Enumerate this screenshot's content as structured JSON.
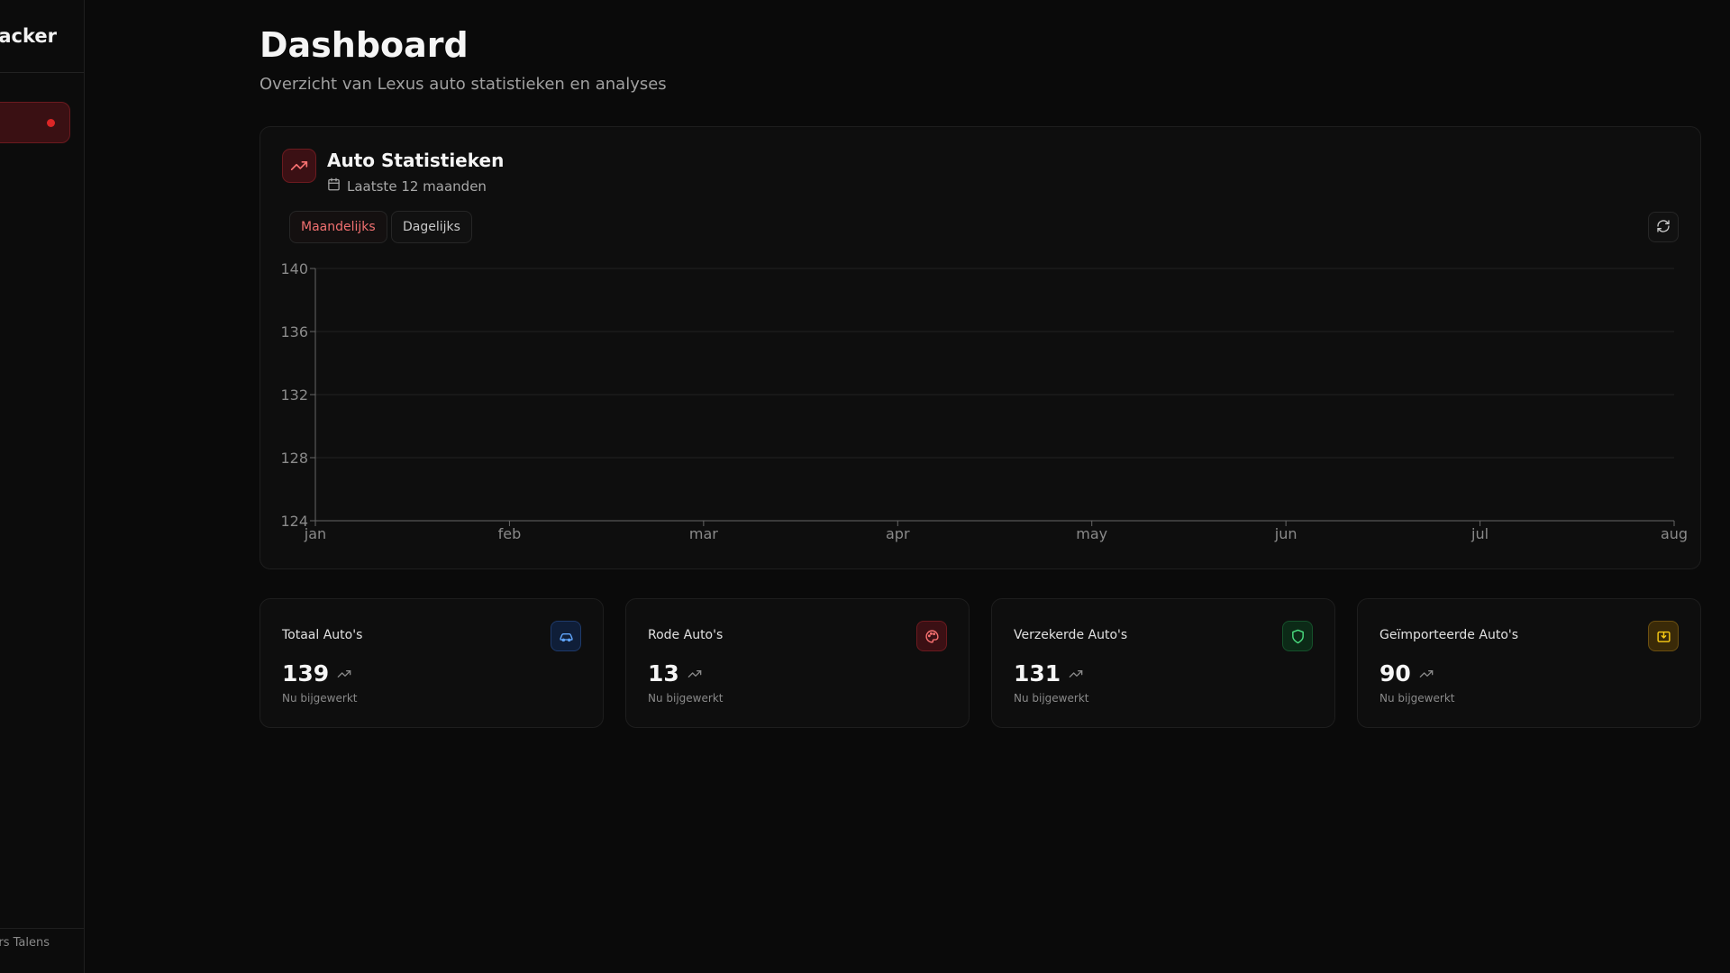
{
  "sidebar": {
    "brand": "Tracker",
    "footer_name": "Lars Talens"
  },
  "header": {
    "title": "Dashboard",
    "subtitle": "Overzicht van Lexus auto statistieken en analyses"
  },
  "stats_card": {
    "title": "Auto Statistieken",
    "subtitle": "Laatste 12 maanden",
    "tabs": [
      {
        "label": "Maandelijks",
        "active": true
      },
      {
        "label": "Dagelijks",
        "active": false
      }
    ],
    "icon": "trending-up-icon",
    "accent": "#f87171"
  },
  "chart_data": {
    "type": "line",
    "categories": [
      "jan",
      "feb",
      "mar",
      "apr",
      "may",
      "jun",
      "jul",
      "aug"
    ],
    "series": [],
    "yticks": [
      124,
      128,
      132,
      136,
      140
    ],
    "ylim": [
      124,
      140
    ],
    "grid": true,
    "title": "",
    "xlabel": "",
    "ylabel": ""
  },
  "kpis": [
    {
      "label": "Totaal Auto's",
      "value": "139",
      "note": "Nu bijgewerkt",
      "icon": "car-icon",
      "color": "#60a5fa"
    },
    {
      "label": "Rode Auto's",
      "value": "13",
      "note": "Nu bijgewerkt",
      "icon": "palette-icon",
      "color": "#f87171"
    },
    {
      "label": "Verzekerde Auto's",
      "value": "131",
      "note": "Nu bijgewerkt",
      "icon": "shield-icon",
      "color": "#4ade80"
    },
    {
      "label": "Geïmporteerde Auto's",
      "value": "90",
      "note": "Nu bijgewerkt",
      "icon": "import-icon",
      "color": "#facc15"
    }
  ]
}
